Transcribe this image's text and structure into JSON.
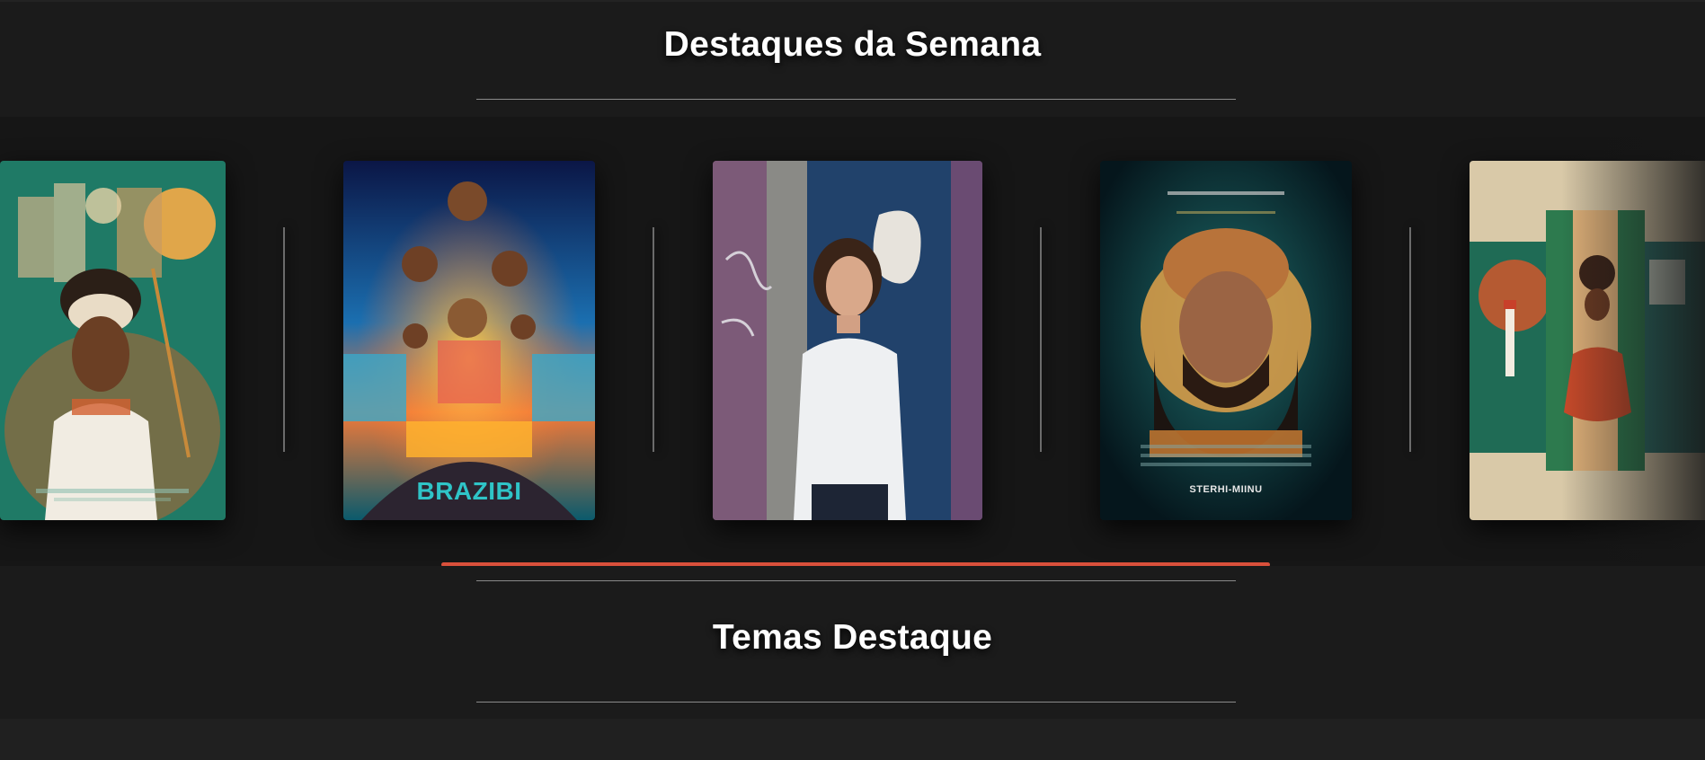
{
  "sections": {
    "highlights_title": "Destaques da Semana",
    "themes_title": "Temas Destaque"
  },
  "carousel": {
    "posters": [
      {
        "name": "poster-bahia-woman",
        "caption": ""
      },
      {
        "name": "poster-brazibi",
        "caption": "BRAZIBI"
      },
      {
        "name": "poster-graffiti-woman",
        "caption": ""
      },
      {
        "name": "poster-bearded-man",
        "caption": "STERHI-MIINU"
      },
      {
        "name": "poster-tropical-collage",
        "caption": ""
      }
    ],
    "progress_color": "#d9503b"
  }
}
